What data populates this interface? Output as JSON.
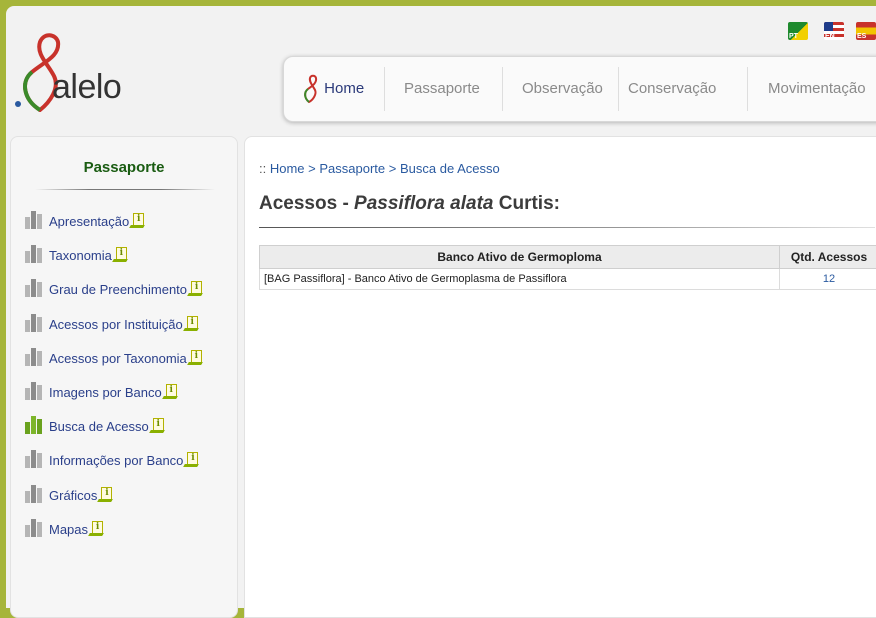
{
  "header": {
    "logo_text": "alelo",
    "languages": [
      {
        "code": "PT",
        "label": "PT"
      },
      {
        "code": "EN",
        "label": "EN"
      },
      {
        "code": "ES",
        "label": "ES"
      }
    ],
    "nav": [
      {
        "label": "Home",
        "icon": "alelo-logo-icon"
      },
      {
        "label": "Passaporte"
      },
      {
        "label": "Observação"
      },
      {
        "label": "Conservação"
      },
      {
        "label": "Movimentação"
      }
    ]
  },
  "sidebar": {
    "title": "Passaporte",
    "items": [
      {
        "label": "Apresentação",
        "active": false
      },
      {
        "label": "Taxonomia",
        "active": false
      },
      {
        "label": "Grau de Preenchimento",
        "active": false
      },
      {
        "label": "Acessos por Instituição",
        "active": false
      },
      {
        "label": "Acessos por Taxonomia",
        "active": false
      },
      {
        "label": "Imagens por Banco",
        "active": false
      },
      {
        "label": "Busca de Acesso",
        "active": true
      },
      {
        "label": "Informações por Banco",
        "active": false
      },
      {
        "label": "Gráficos",
        "active": false
      },
      {
        "label": "Mapas",
        "active": false
      }
    ]
  },
  "main": {
    "breadcrumb": {
      "prefix": "::",
      "items": [
        "Home",
        "Passaporte",
        "Busca de Acesso"
      ],
      "separator": ">"
    },
    "title": {
      "prefix": "Acessos - ",
      "species": "Passiflora alata",
      "suffix": " Curtis:"
    },
    "table": {
      "headers": [
        "Banco Ativo de Germoploma",
        "Qtd. Acessos"
      ],
      "rows": [
        {
          "bank": "[BAG Passiflora] - Banco Ativo de Germoplasma de Passiflora",
          "count": "12"
        }
      ]
    }
  },
  "colors": {
    "background_border": "#a6b53a",
    "brand_green": "#1a5c12",
    "link_blue": "#2a5aa0",
    "active_bar_green": "#6aa21e",
    "inactive_bar_gray": "#8c8c8c"
  }
}
